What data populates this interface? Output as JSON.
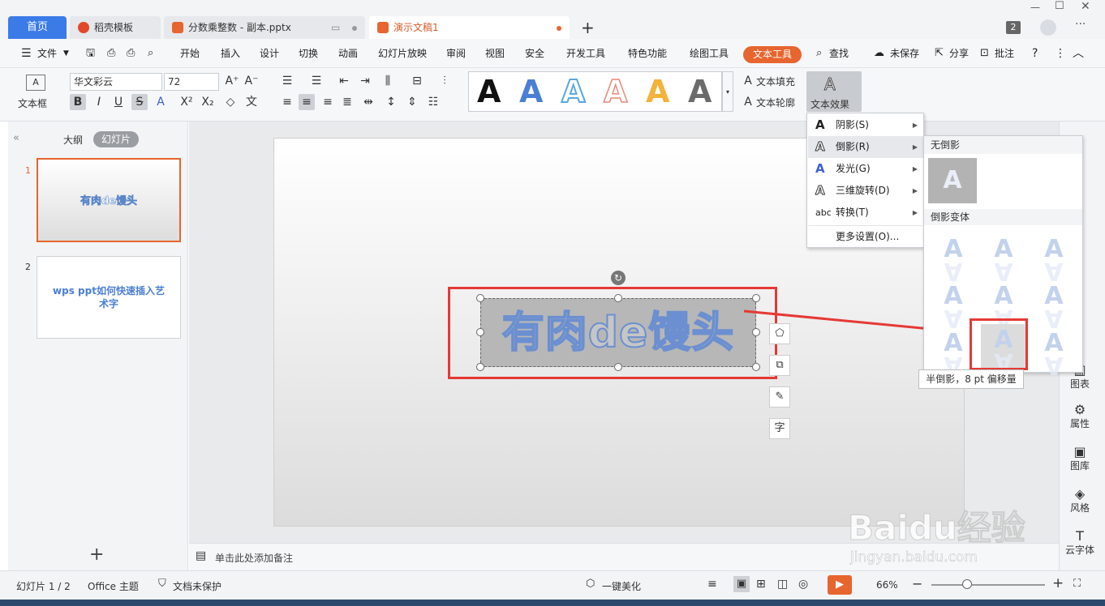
{
  "tabs": [
    {
      "label": "首页"
    },
    {
      "label": "稻壳模板"
    },
    {
      "label": "分数乘整数 - 副本.pptx"
    },
    {
      "label": "演示文稿1"
    }
  ],
  "title_badge": "2",
  "menus": {
    "file": "文件",
    "start": "开始",
    "insert": "插入",
    "design": "设计",
    "switch": "切换",
    "animation": "动画",
    "slideshow": "幻灯片放映",
    "review": "审阅",
    "view": "视图",
    "security": "安全",
    "devtools": "开发工具",
    "special": "特色功能",
    "drawtools": "绘图工具",
    "texttools": "文本工具",
    "find": "查找",
    "unsaved": "未保存",
    "share": "分享",
    "annotate": "批注"
  },
  "ribbon": {
    "textbox_label": "文本框",
    "font_name": "华文彩云",
    "font_size": "72",
    "text_fill": "文本填充",
    "text_outline": "文本轮廓",
    "text_effect": "文本效果",
    "gallery_letter": "A"
  },
  "left_panel": {
    "outline_tab": "大纲",
    "slides_tab": "幻灯片",
    "slide1_num": "1",
    "slide1_text": "有肉de馒头",
    "slide2_num": "2",
    "slide2_text": "wps ppt如何快速插入艺术字"
  },
  "slide": {
    "wordart": "有肉de馒头"
  },
  "float_tools": {
    "font_icon": "字"
  },
  "notes_placeholder": "单击此处添加备注",
  "effect_menu": [
    {
      "label": "阴影(S)",
      "icon": "A"
    },
    {
      "label": "倒影(R)",
      "icon": "A"
    },
    {
      "label": "发光(G)",
      "icon": "A"
    },
    {
      "label": "三维旋转(D)",
      "icon": "A"
    },
    {
      "label": "转换(T)",
      "icon": "abc"
    },
    {
      "label": "更多设置(O)...",
      "icon": ""
    }
  ],
  "reflection_panel": {
    "no_reflection": "无倒影",
    "variants": "倒影变体",
    "letter": "A"
  },
  "tooltip": "半倒影，8 pt 偏移量",
  "right_sidebar": [
    "图表",
    "属性",
    "图库",
    "风格",
    "云字体"
  ],
  "status": {
    "slide_count": "幻灯片 1 / 2",
    "theme": "Office 主题",
    "protect": "文档未保护",
    "beautify": "一键美化",
    "zoom": "66%"
  },
  "watermark": {
    "brand": "Baidu经验",
    "url": "jingyan.baidu.com"
  },
  "colors": {
    "accent_orange": "#e7652e",
    "home_blue": "#3b7be8",
    "highlight_red": "#e53935"
  }
}
